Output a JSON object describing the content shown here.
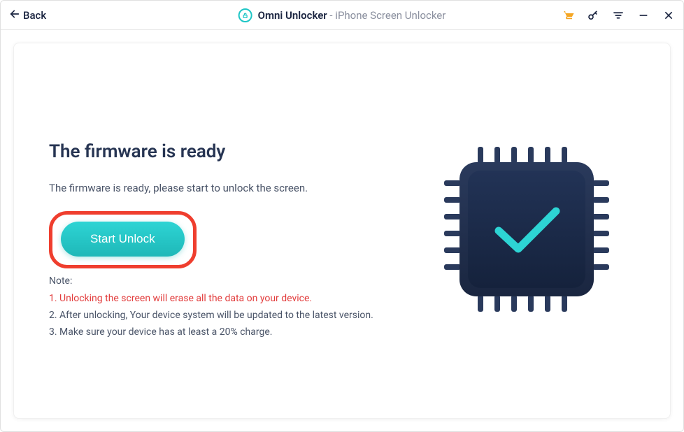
{
  "titlebar": {
    "back_label": "Back",
    "app_name": "Omni Unlocker",
    "app_subtitle": " - iPhone Screen Unlocker"
  },
  "main": {
    "heading": "The firmware is ready",
    "subtext": "The firmware is ready, please start to unlock the screen.",
    "start_button_label": "Start Unlock",
    "note_label": "Note:",
    "notes": {
      "n1": "1. Unlocking the screen will erase all the data on your device.",
      "n2": "2. After unlocking, Your device system will be updated to the latest version.",
      "n3": "3. Make sure your device has at least a 20% charge."
    }
  },
  "icons": {
    "back": "back-arrow-icon",
    "app": "lock-circle-icon",
    "cart": "cart-icon",
    "key": "key-icon",
    "menu": "menu-lines-icon",
    "minimize": "minimize-icon",
    "close": "close-icon",
    "chip": "chip-check-icon"
  }
}
